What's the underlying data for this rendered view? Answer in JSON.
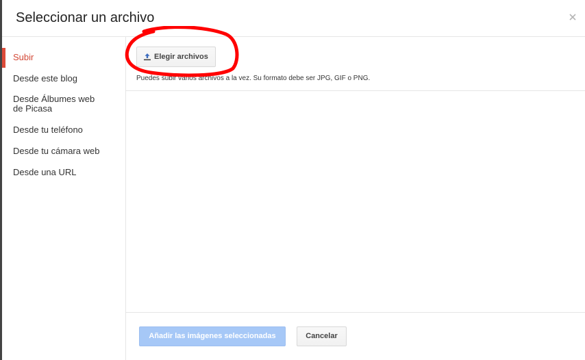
{
  "dialog": {
    "title": "Seleccionar un archivo",
    "close_icon": "close-icon"
  },
  "sidebar": {
    "items": [
      {
        "label": "Subir",
        "active": true
      },
      {
        "label": "Desde este blog",
        "active": false
      },
      {
        "label": "Desde Álbumes web de Picasa",
        "active": false
      },
      {
        "label": "Desde tu teléfono",
        "active": false
      },
      {
        "label": "Desde tu cámara web",
        "active": false
      },
      {
        "label": "Desde una URL",
        "active": false
      }
    ],
    "active_color": "#dd4b39"
  },
  "upload": {
    "choose_label": "Elegir archivos",
    "upload_icon": "upload-icon",
    "hint": "Puedes subir varios archivos a la vez. Su formato debe ser JPG, GIF o PNG."
  },
  "footer": {
    "add_label": "Añadir las imágenes seleccionadas",
    "cancel_label": "Cancelar",
    "add_color": "#a6c8f7"
  },
  "annotation": {
    "color": "#ff0000"
  }
}
